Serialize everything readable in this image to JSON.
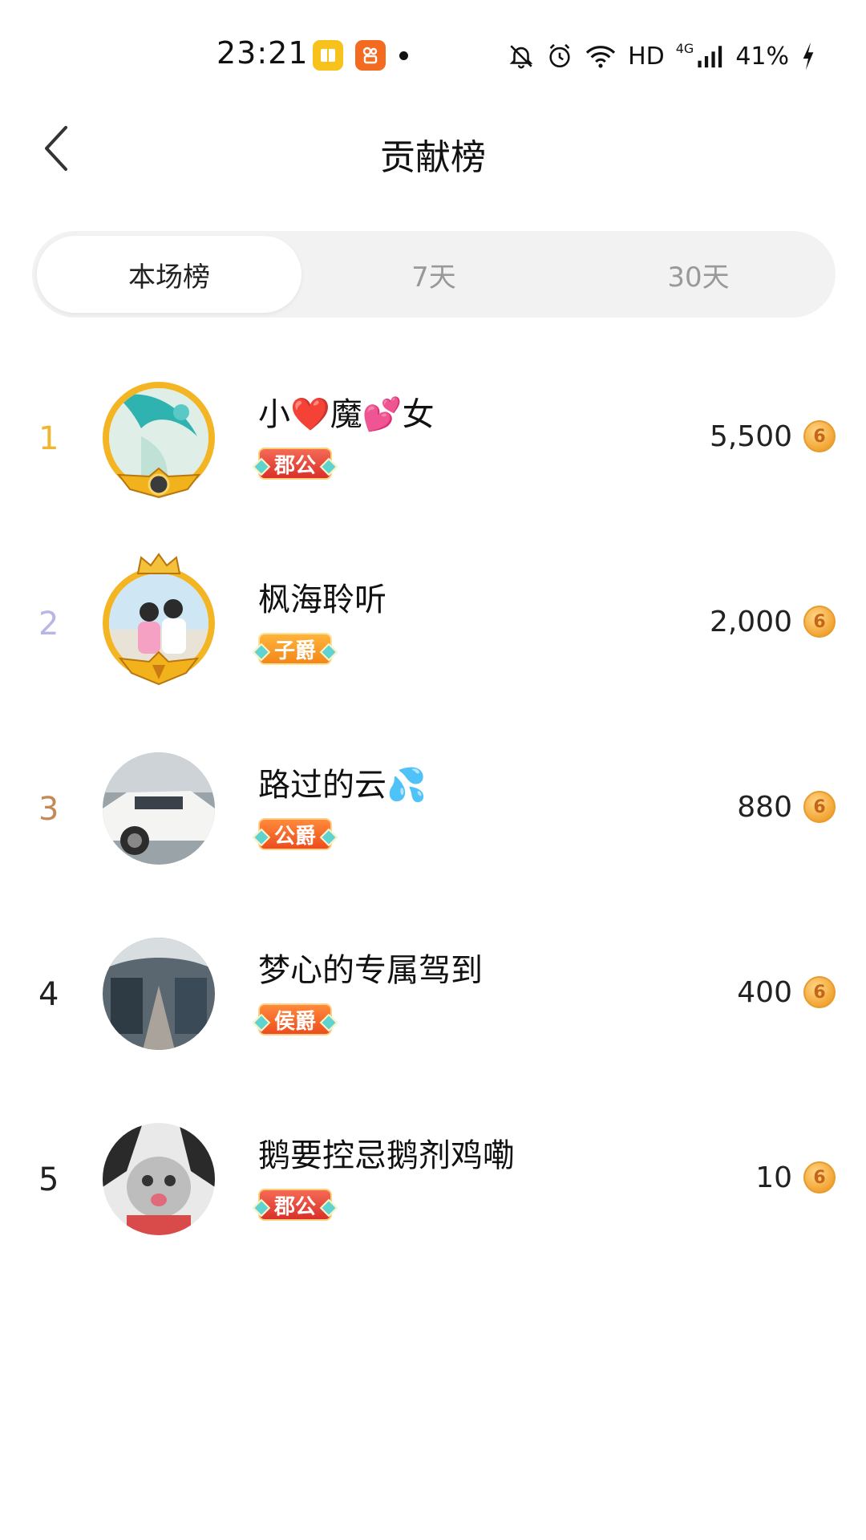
{
  "status_bar": {
    "time": "23:21",
    "network_label": "4G",
    "hd_label": "HD",
    "battery": "41%",
    "icons": [
      "notification-app-icon",
      "kuaishou-app-icon",
      "dot-indicator",
      "bell-muted-icon",
      "alarm-icon",
      "wifi-icon",
      "signal-icon",
      "charging-icon"
    ]
  },
  "header": {
    "title": "贡献榜",
    "back_icon": "chevron-left-icon"
  },
  "tabs": [
    {
      "label": "本场榜",
      "active": true
    },
    {
      "label": "7天",
      "active": false
    },
    {
      "label": "30天",
      "active": false
    }
  ],
  "ranking": [
    {
      "rank": "1",
      "name": "小❤️魔💕女",
      "badge": "郡公",
      "amount": "5,500",
      "coin_glyph": "6"
    },
    {
      "rank": "2",
      "name": "枫海聆听",
      "badge": "子爵",
      "amount": "2,000",
      "coin_glyph": "6"
    },
    {
      "rank": "3",
      "name": "路过的云💦",
      "badge": "公爵",
      "amount": "880",
      "coin_glyph": "6"
    },
    {
      "rank": "4",
      "name": "梦心的专属驾到",
      "badge": "侯爵",
      "amount": "400",
      "coin_glyph": "6"
    },
    {
      "rank": "5",
      "name": "鹅要控忌鹅剂鸡嘞",
      "badge": "郡公",
      "amount": "10",
      "coin_glyph": "6"
    }
  ],
  "colors": {
    "rank1": "#f0b630",
    "rank2": "#b7b6e6",
    "rank3": "#c48a56",
    "tab_bg": "#f2f2f2",
    "coin": "#f2a533"
  }
}
